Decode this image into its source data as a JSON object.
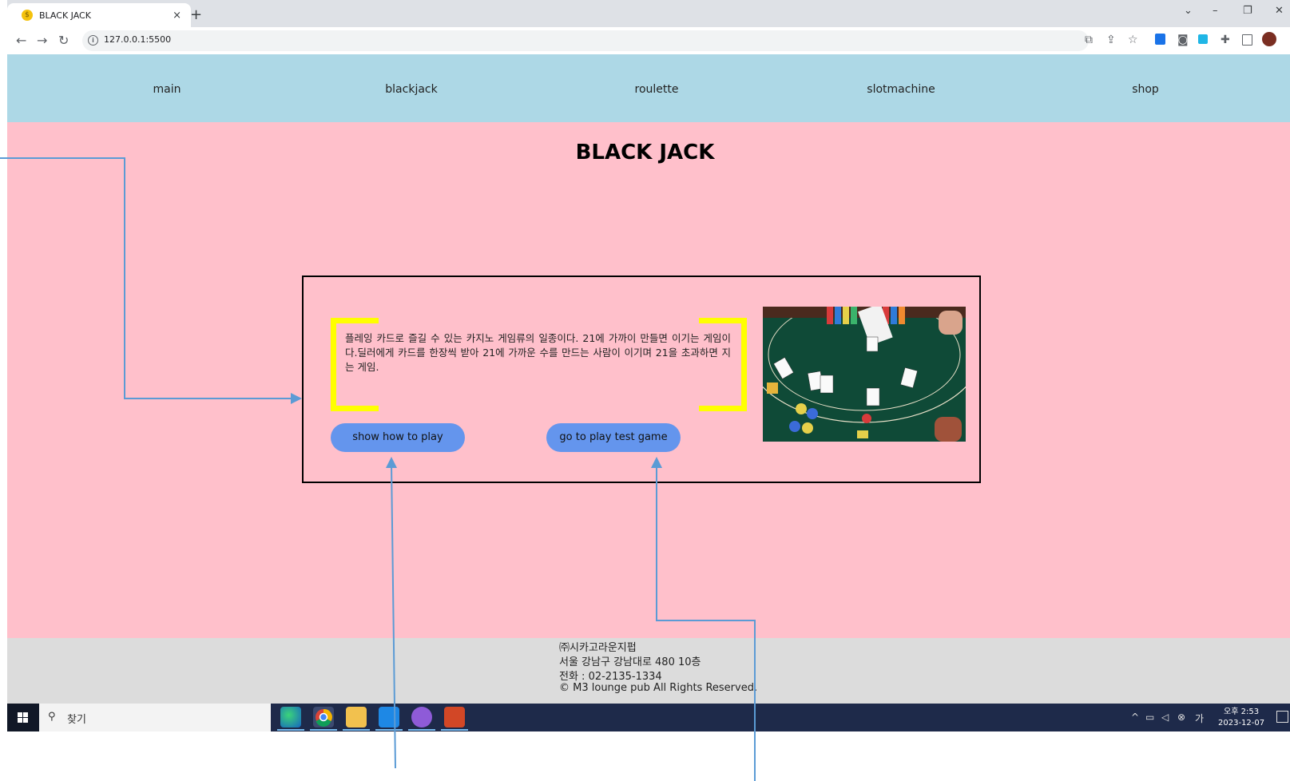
{
  "browser": {
    "tab_title": "BLACK JACK",
    "tab_favicon": "$",
    "close_glyph": "×",
    "new_tab_glyph": "+",
    "url": "127.0.0.1:5500",
    "window_controls": [
      "⌄",
      "–",
      "❐",
      "✕"
    ]
  },
  "nav": {
    "items": [
      {
        "label": "main"
      },
      {
        "label": "blackjack"
      },
      {
        "label": "roulette"
      },
      {
        "label": "slotmachine"
      },
      {
        "label": "shop"
      }
    ]
  },
  "main": {
    "title": "BLACK JACK",
    "description": "플레잉 카드로 즐길 수 있는 카지노 게임류의 일종이다. 21에 가까이 만들면 이기는 게임이다.딜러에게 카드를 한장씩 받아 21에 가까운 수를 만드는 사람이 이기며 21을 초과하면 지는 게임.",
    "buttons": {
      "how_to_play": "show how to play",
      "play_test": "go to play test game"
    }
  },
  "footer": {
    "company": "㈜시카고라운지펍",
    "address": "서울 강남구 강남대로 480 10층",
    "phone": "전화 : 02-2135-1334",
    "copyright": "© M3 lounge pub All Rights Reserved."
  },
  "taskbar": {
    "search_placeholder": "찾기",
    "time": "오후 2:53",
    "date": "2023-12-07",
    "apps": [
      "edge-icon",
      "chrome-icon",
      "file-explorer-icon",
      "vscode-icon",
      "github-icon",
      "powerpoint-icon"
    ]
  },
  "colors": {
    "nav_bg": "#add8e6",
    "main_bg": "#ffc0cb",
    "button_bg": "#6495ed",
    "bracket": "#ffff00",
    "arrow": "#5b9bd5"
  }
}
